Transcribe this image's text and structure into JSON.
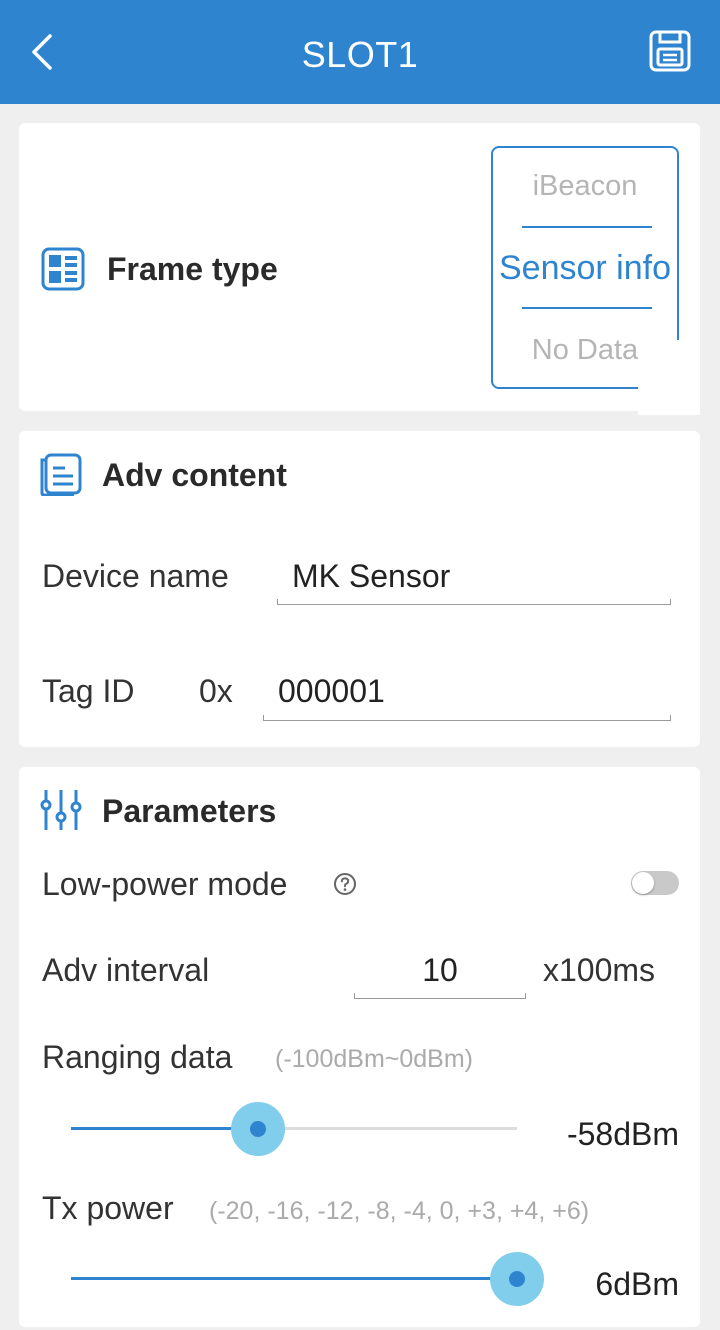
{
  "header": {
    "title": "SLOT1"
  },
  "frame_type": {
    "title": "Frame type",
    "options": [
      "iBeacon",
      "Sensor info",
      "No Data"
    ],
    "selected": "Sensor info"
  },
  "adv_content": {
    "title": "Adv content",
    "device_name_label": "Device name",
    "device_name_value": "MK Sensor",
    "tag_id_label": "Tag ID",
    "tag_id_prefix": "0x",
    "tag_id_value": "000001"
  },
  "parameters": {
    "title": "Parameters",
    "low_power_label": "Low-power mode",
    "low_power_on": false,
    "adv_interval_label": "Adv interval",
    "adv_interval_value": "10",
    "adv_interval_unit": "x100ms",
    "ranging_label": "Ranging data",
    "ranging_hint": "(-100dBm~0dBm)",
    "ranging_value": "-58dBm",
    "ranging_fraction": 0.42,
    "tx_label": "Tx power",
    "tx_hint": "(-20, -16, -12, -8, -4, 0, +3, +4, +6)",
    "tx_value": "6dBm",
    "tx_fraction": 1.0
  },
  "colors": {
    "accent": "#2f84d0",
    "thumb_halo": "#80cdec",
    "background": "#efefef"
  }
}
